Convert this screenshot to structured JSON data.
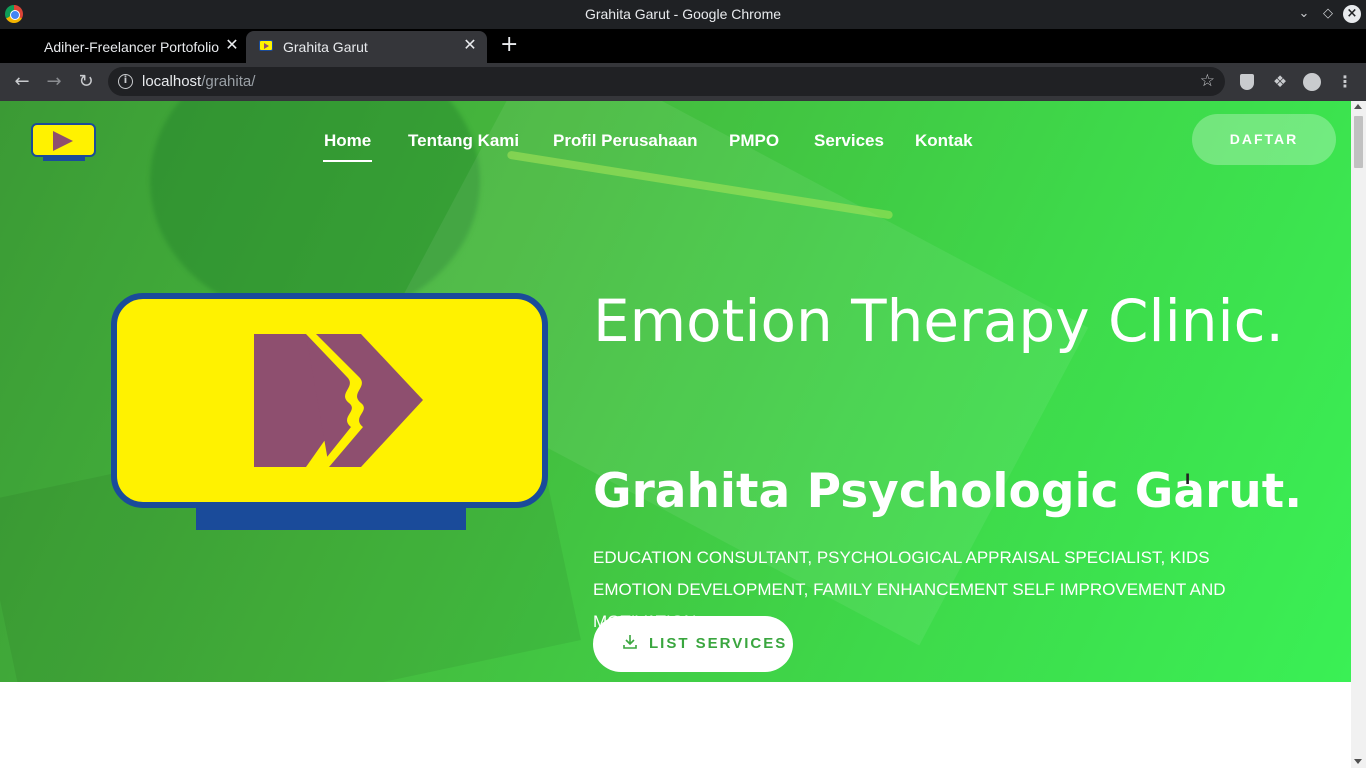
{
  "window": {
    "title": "Grahita Garut - Google Chrome"
  },
  "tabs": [
    {
      "label": "Adiher-Freelancer Portofolio",
      "active": false
    },
    {
      "label": "Grahita Garut",
      "active": true
    }
  ],
  "address_bar": {
    "host": "localhost",
    "path": "/grahita/"
  },
  "site": {
    "nav": [
      {
        "label": "Home",
        "active": true
      },
      {
        "label": "Tentang Kami",
        "active": false
      },
      {
        "label": "Profil Perusahaan",
        "active": false
      },
      {
        "label": "PMPO",
        "active": false
      },
      {
        "label": "Services",
        "active": false
      },
      {
        "label": "Kontak",
        "active": false
      }
    ],
    "daftar_label": "DAFTAR"
  },
  "hero": {
    "title": "Emotion Therapy Clinic.",
    "subtitle": "Grahita Psychologic Garut.",
    "description": "EDUCATION CONSULTANT, PSYCHOLOGICAL APPRAISAL SPECIALIST, KIDS EMOTION DEVELOPMENT, FAMILY ENHANCEMENT SELF IMPROVEMENT AND MOTIVATION.",
    "cta_label": "LIST SERVICES"
  },
  "colors": {
    "hero_green": "#45b83d",
    "logo_yellow": "#fff200",
    "logo_blue": "#1a4b9a",
    "logo_purple": "#8e4f6f",
    "cta_text": "#3aa63f"
  }
}
